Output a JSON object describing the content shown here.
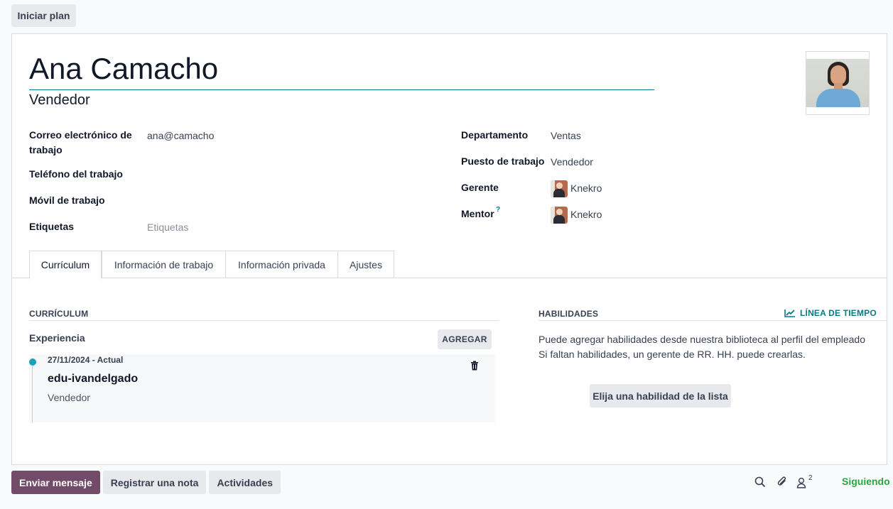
{
  "top_bar": {
    "start_plan": "Iniciar plan"
  },
  "employee": {
    "name": "Ana Camacho",
    "job_title": "Vendedor",
    "fields_left": {
      "work_email_label": "Correo electrónico de trabajo",
      "work_email": "ana@camacho",
      "work_phone_label": "Teléfono del trabajo",
      "work_mobile_label": "Móvil de trabajo",
      "tags_label": "Etiquetas",
      "tags_placeholder": "Etiquetas"
    },
    "fields_right": {
      "department_label": "Departamento",
      "department": "Ventas",
      "job_position_label": "Puesto de trabajo",
      "job_position": "Vendedor",
      "manager_label": "Gerente",
      "manager": "Knekro",
      "mentor_label": "Mentor",
      "mentor_help": "?",
      "mentor": "Knekro"
    }
  },
  "tabs": [
    {
      "label": "Currículum",
      "active": true
    },
    {
      "label": "Información de trabajo",
      "active": false
    },
    {
      "label": "Información privada",
      "active": false
    },
    {
      "label": "Ajustes",
      "active": false
    }
  ],
  "resume": {
    "section_title": "CURRÍCULUM",
    "experience_label": "Experiencia",
    "add_label": "AGREGAR",
    "entries": [
      {
        "date": "27/11/2024 - Actual",
        "title": "edu-ivandelgado",
        "description": "Vendedor"
      }
    ]
  },
  "skills": {
    "section_title": "HABILIDADES",
    "timeline_label": "LÍNEA DE TIEMPO",
    "info_line1": "Puede agregar habilidades desde nuestra biblioteca al perfil del empleado",
    "info_line2": "Si faltan habilidades, un gerente de RR. HH. puede crearlas.",
    "pick_label": "Elija una habilidad de la lista"
  },
  "chatter": {
    "send_message": "Enviar mensaje",
    "log_note": "Registrar una nota",
    "activities": "Actividades",
    "followers_count": "2",
    "following": "Siguiendo"
  },
  "colors": {
    "primary": "#714b67",
    "accent": "#017e84",
    "following": "#28a745"
  },
  "icons": [
    "search-icon",
    "paperclip-icon",
    "user-icon",
    "trash-icon",
    "chart-line-icon"
  ]
}
